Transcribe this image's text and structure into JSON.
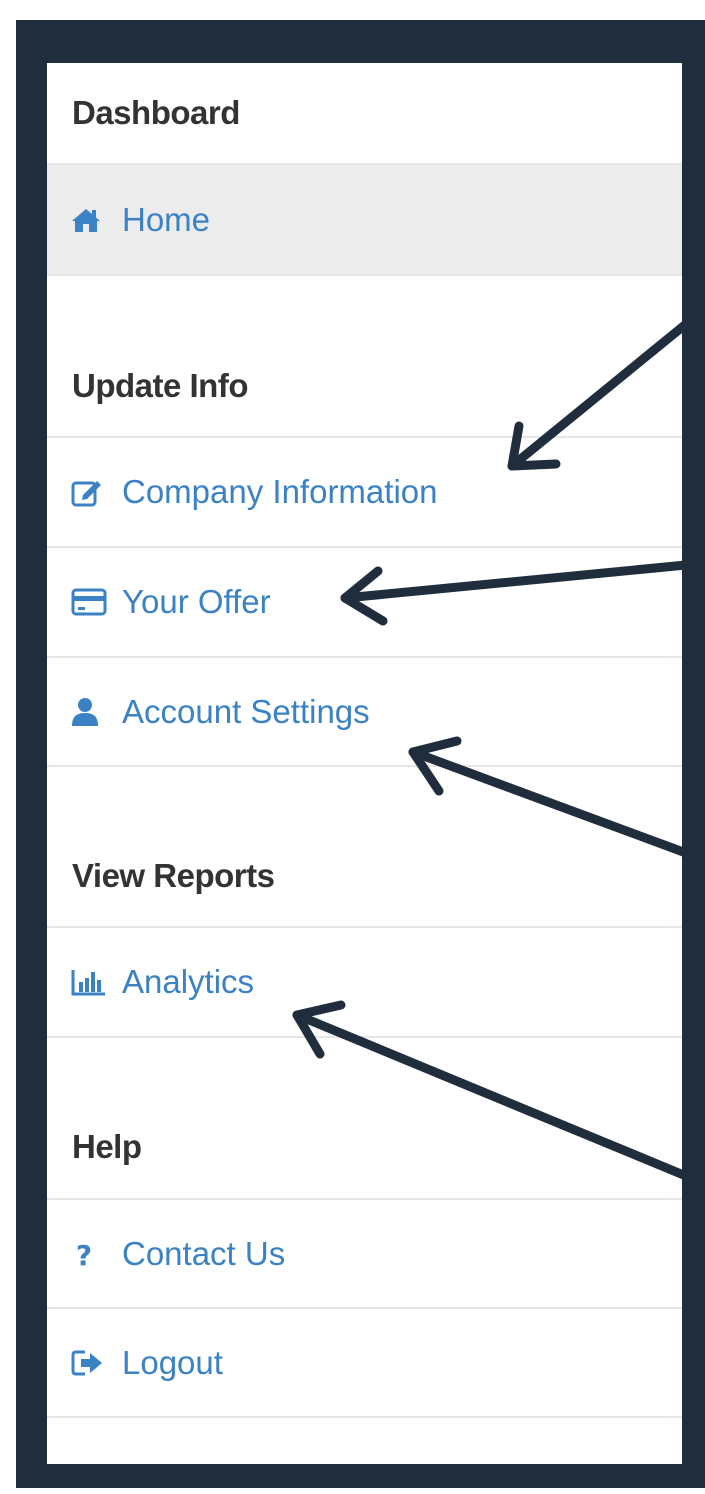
{
  "sidebar": {
    "sections": [
      {
        "header": "Dashboard",
        "items": [
          {
            "label": "Home",
            "icon": "home-icon",
            "active": true
          }
        ]
      },
      {
        "header": "Update Info",
        "items": [
          {
            "label": "Company Information",
            "icon": "edit-icon"
          },
          {
            "label": "Your Offer",
            "icon": "credit-card-icon"
          },
          {
            "label": "Account Settings",
            "icon": "user-icon"
          }
        ]
      },
      {
        "header": "View Reports",
        "items": [
          {
            "label": "Analytics",
            "icon": "bar-chart-icon"
          }
        ]
      },
      {
        "header": "Help",
        "items": [
          {
            "label": "Contact Us",
            "icon": "question-icon"
          },
          {
            "label": "Logout",
            "icon": "logout-icon"
          }
        ]
      }
    ]
  },
  "colors": {
    "frame": "#1f2d3d",
    "link": "#3b82c4",
    "header_text": "#333333",
    "active_bg": "#ececec",
    "divider": "#e6e6e6",
    "arrow": "#1f2d3d"
  }
}
